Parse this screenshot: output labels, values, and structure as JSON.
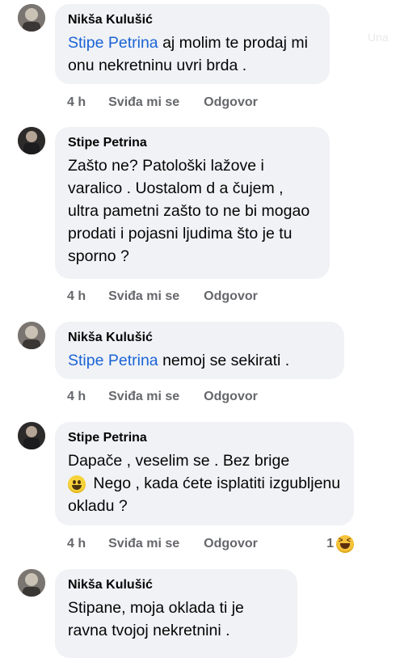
{
  "ghost_text": "Una",
  "comments": [
    {
      "author": "Nikša Kulušić",
      "mention": "Stipe Petrina",
      "text": " aj molim te prodaj mi onu nekretninu uvri brda .",
      "time": "4 h",
      "like_label": "Sviđa mi se",
      "reply_label": "Odgovor"
    },
    {
      "author": "Stipe Petrina",
      "text": "Zašto ne? Patološki lažove i varalico . Uostalom d a čujem , ultra pametni zašto to ne bi mogao prodati i pojasni ljudima što je tu sporno ?",
      "time": "4 h",
      "like_label": "Sviđa mi se",
      "reply_label": "Odgovor"
    },
    {
      "author": "Nikša Kulušić",
      "mention": "Stipe Petrina",
      "text": " nemoj se sekirati .",
      "time": "4 h",
      "like_label": "Sviđa mi se",
      "reply_label": "Odgovor"
    },
    {
      "author": "Stipe Petrina",
      "text_before_emoji": "Dapače , veselim se . Bez brige",
      "text_after_emoji": "Nego , kada ćete isplatiti izgubljenu okladu ?",
      "time": "4 h",
      "like_label": "Sviđa mi se",
      "reply_label": "Odgovor",
      "reaction_count": "1"
    },
    {
      "author": "Nikša Kulušić",
      "text": "Stipane, moja oklada ti je ravna tvojoj nekretnini ."
    }
  ],
  "icons": {
    "avatar_nikša": "avatar-photo",
    "avatar_stipe": "avatar-photo",
    "emoji": "grinning-face",
    "reaction": "haha-reaction"
  },
  "colors": {
    "bubble": "#f0f2f5",
    "mention": "#1b64d6",
    "meta": "#65676b"
  }
}
